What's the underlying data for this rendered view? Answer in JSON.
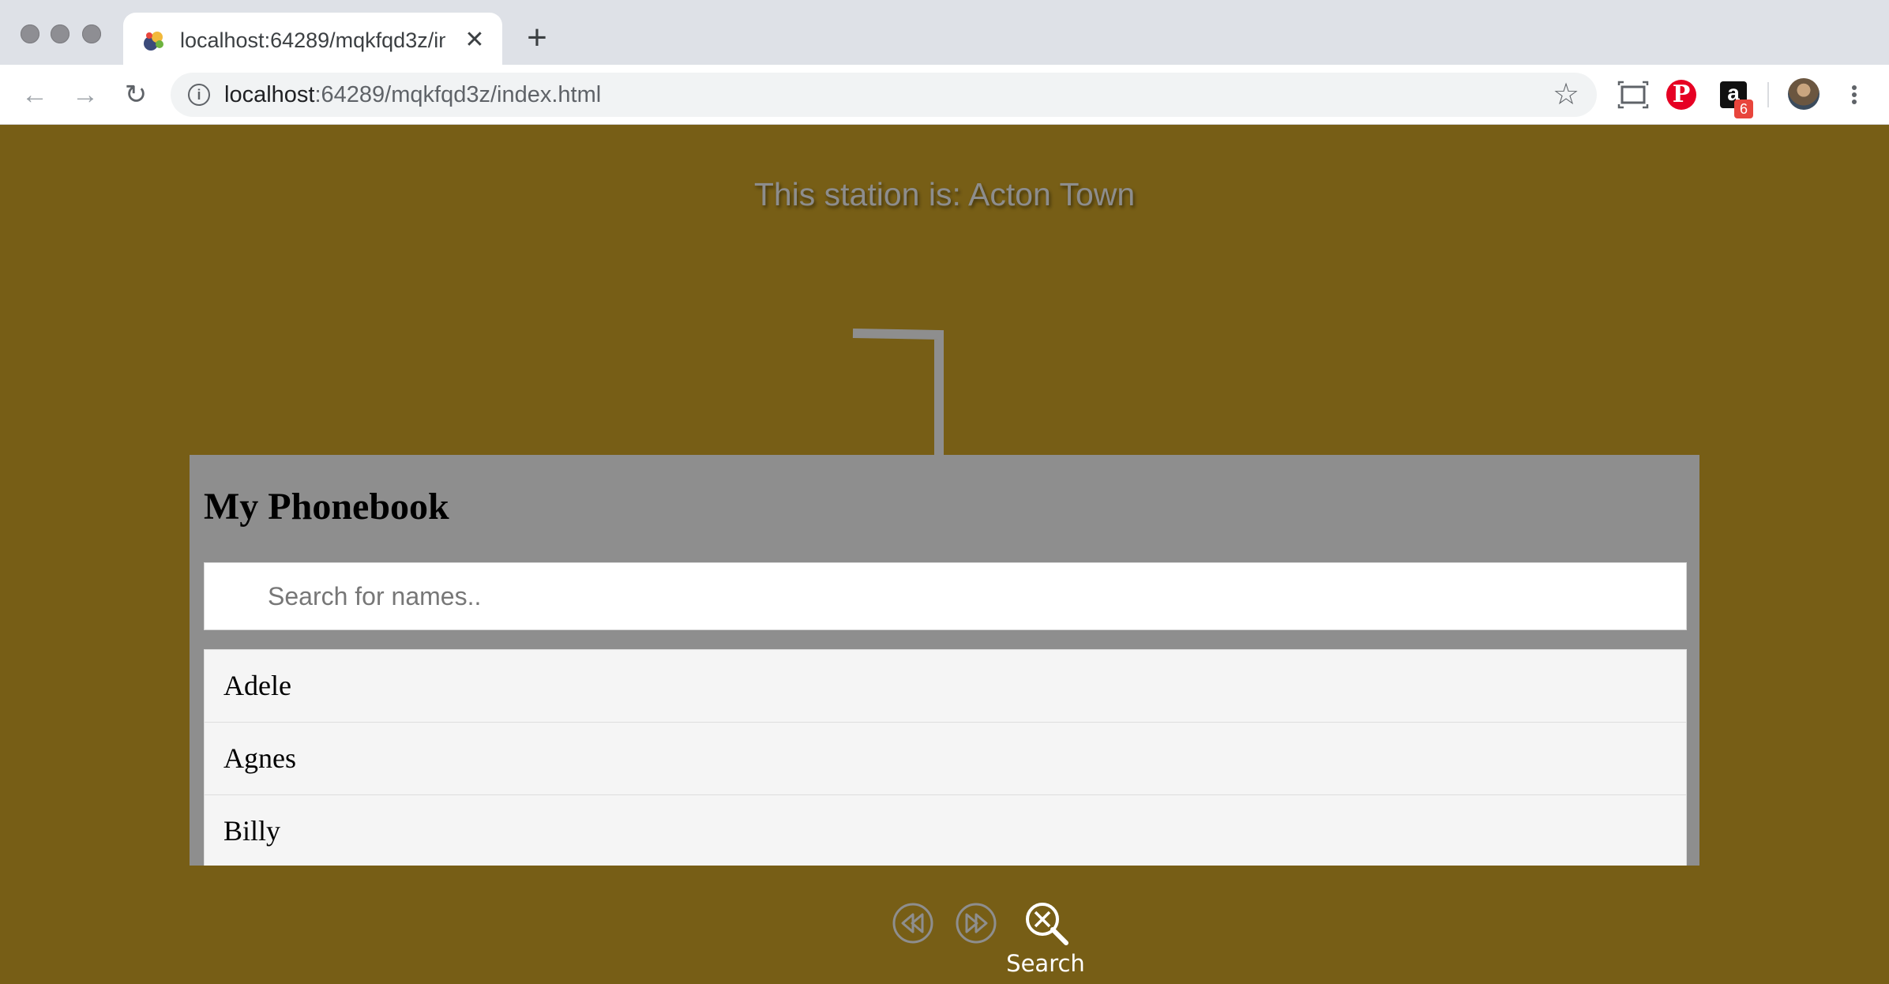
{
  "browser": {
    "tab_title": "localhost:64289/mqkfqd3z/index.html",
    "new_tab_label": "+",
    "url_host": "localhost",
    "url_rest": ":64289/mqkfqd3z/index.html",
    "amazon_label": "a",
    "amazon_badge": "6",
    "pinterest_label": "P"
  },
  "page": {
    "station_text": "This station is: Acton Town",
    "background_color": "#775e16"
  },
  "phonebook": {
    "title": "My Phonebook",
    "search_placeholder": "Search for names..",
    "search_value": "",
    "items": [
      {
        "name": "Adele"
      },
      {
        "name": "Agnes"
      },
      {
        "name": "Billy"
      }
    ]
  },
  "controls": {
    "search_label": "Search"
  }
}
